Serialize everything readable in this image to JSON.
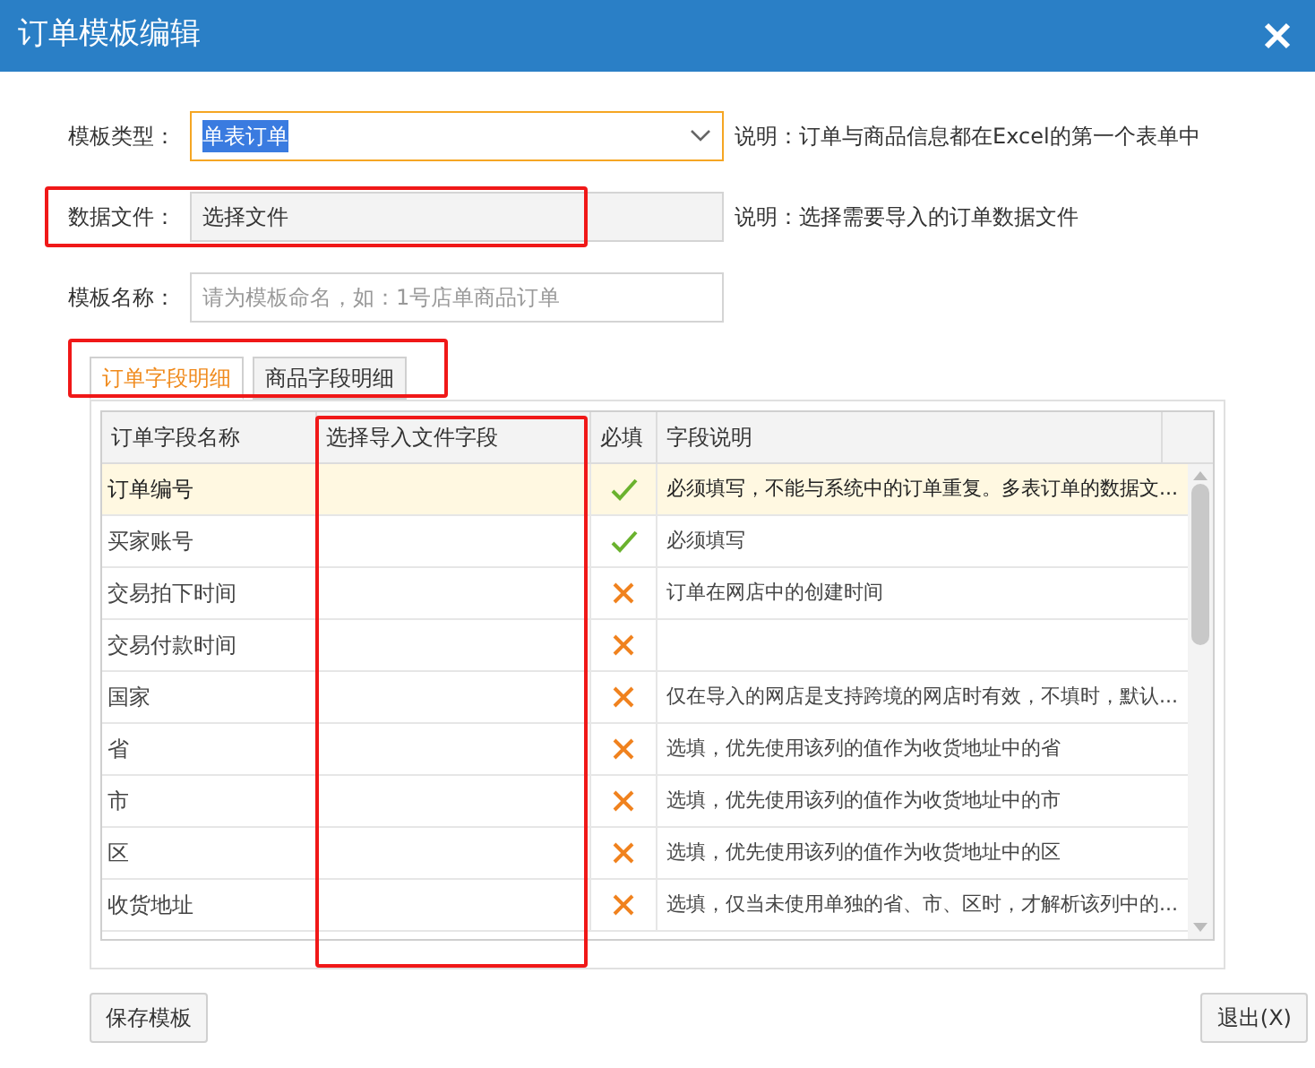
{
  "window": {
    "title": "订单模板编辑"
  },
  "form": [
    {
      "label": "模板类型：",
      "kind": "select",
      "value": "单表订单",
      "value_selected": true,
      "note": "说明：订单与商品信息都在Excel的第一个表单中",
      "highlighted": false
    },
    {
      "label": "数据文件：",
      "kind": "file",
      "value": "选择文件",
      "note": "说明：选择需要导入的订单数据文件",
      "highlighted": true
    },
    {
      "label": "模板名称：",
      "kind": "text",
      "placeholder": "请为模板命名，如：1号店单商品订单",
      "highlighted": false
    }
  ],
  "tabs_highlighted": true,
  "tabs": [
    {
      "label": "订单字段明细",
      "selected": true
    },
    {
      "label": "商品字段明细",
      "selected": false
    }
  ],
  "table": {
    "columns": [
      {
        "label": "订单字段名称",
        "highlighted": false
      },
      {
        "label": "选择导入文件字段",
        "highlighted": true
      },
      {
        "label": "必填",
        "highlighted": false
      },
      {
        "label": "字段说明",
        "highlighted": false
      }
    ],
    "rows": [
      {
        "name": "订单编号",
        "required": true,
        "description": "必须填写，不能与系统中的订单重复。多表订单的数据文...",
        "selected": true
      },
      {
        "name": "买家账号",
        "required": true,
        "description": "必须填写",
        "selected": false
      },
      {
        "name": "交易拍下时间",
        "required": false,
        "description": "订单在网店中的创建时间",
        "selected": false
      },
      {
        "name": "交易付款时间",
        "required": false,
        "selected": false
      },
      {
        "name": "国家",
        "required": false,
        "description": "仅在导入的网店是支持跨境的网店时有效，不填时，默认...",
        "selected": false
      },
      {
        "name": "省",
        "required": false,
        "description": "选填，优先使用该列的值作为收货地址中的省",
        "selected": false
      },
      {
        "name": "市",
        "required": false,
        "description": "选填，优先使用该列的值作为收货地址中的市",
        "selected": false
      },
      {
        "name": "区",
        "required": false,
        "description": "选填，优先使用该列的值作为收货地址中的区",
        "selected": false
      },
      {
        "name": "收货地址",
        "required": false,
        "description": "选填，仅当未使用单独的省、市、区时，才解析该列中的...",
        "selected": false
      }
    ]
  },
  "buttons": [
    {
      "label": "保存模板",
      "kind": "left"
    },
    {
      "label": "退出(X)",
      "kind": "right"
    }
  ]
}
